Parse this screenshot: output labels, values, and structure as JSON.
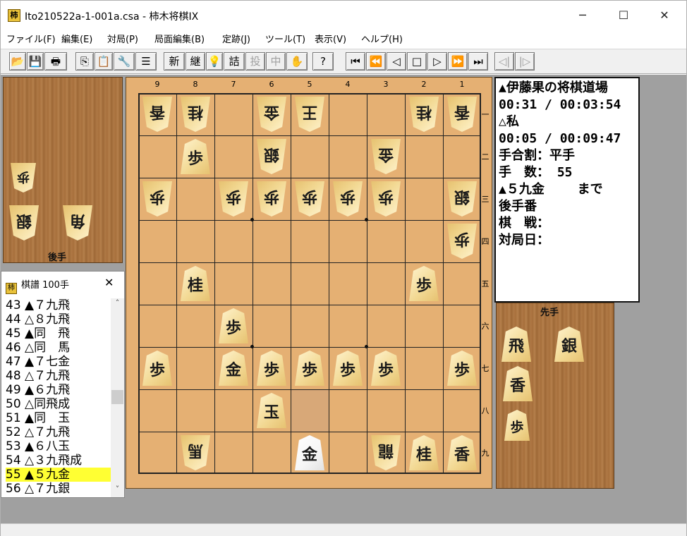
{
  "window": {
    "title": "Ito210522a-1-001a.csa - 柿木将棋IX",
    "app_icon": "柿",
    "minimize": "─",
    "maximize": "☐",
    "close": "✕"
  },
  "menu": [
    "ファイル(F)",
    "編集(E)",
    "対局(P)",
    "局面編集(B)",
    "定跡(J)",
    "ツール(T)",
    "表示(V)",
    "ヘルプ(H)"
  ],
  "toolbar": {
    "open": "📂",
    "save": "💾",
    "print": "🖶",
    "copy": "⎘",
    "paste": "📋",
    "tool": "🔧",
    "list": "☰",
    "new": "新",
    "continue": "継",
    "hint": "💡",
    "tsume": "詰",
    "resign": "投",
    "pause": "中",
    "hand": "✋",
    "help": "?",
    "first": "⏮",
    "back10": "⏪",
    "back": "◁",
    "stop": "□",
    "forward": "▷",
    "forward10": "⏩",
    "last": "⏭",
    "branch_back": "◁|",
    "branch_fwd": "|▷"
  },
  "board": {
    "file_labels": [
      "9",
      "8",
      "7",
      "6",
      "5",
      "4",
      "3",
      "2",
      "1"
    ],
    "rank_labels": [
      "一",
      "二",
      "三",
      "四",
      "五",
      "六",
      "七",
      "八",
      "九"
    ],
    "highlight_square": "5八",
    "pieces": [
      {
        "file": 9,
        "rank": 1,
        "char": "香",
        "owner": "gote"
      },
      {
        "file": 8,
        "rank": 1,
        "char": "桂",
        "owner": "gote"
      },
      {
        "file": 6,
        "rank": 1,
        "char": "金",
        "owner": "gote"
      },
      {
        "file": 5,
        "rank": 1,
        "char": "王",
        "owner": "gote"
      },
      {
        "file": 2,
        "rank": 1,
        "char": "桂",
        "owner": "gote"
      },
      {
        "file": 1,
        "rank": 1,
        "char": "香",
        "owner": "gote"
      },
      {
        "file": 8,
        "rank": 2,
        "char": "歩",
        "owner": "sente"
      },
      {
        "file": 6,
        "rank": 2,
        "char": "銀",
        "owner": "gote"
      },
      {
        "file": 3,
        "rank": 2,
        "char": "金",
        "owner": "gote"
      },
      {
        "file": 9,
        "rank": 3,
        "char": "歩",
        "owner": "gote"
      },
      {
        "file": 7,
        "rank": 3,
        "char": "歩",
        "owner": "gote"
      },
      {
        "file": 6,
        "rank": 3,
        "char": "歩",
        "owner": "gote"
      },
      {
        "file": 5,
        "rank": 3,
        "char": "歩",
        "owner": "gote"
      },
      {
        "file": 4,
        "rank": 3,
        "char": "歩",
        "owner": "gote"
      },
      {
        "file": 3,
        "rank": 3,
        "char": "歩",
        "owner": "gote"
      },
      {
        "file": 1,
        "rank": 3,
        "char": "銀",
        "owner": "gote"
      },
      {
        "file": 1,
        "rank": 4,
        "char": "歩",
        "owner": "gote"
      },
      {
        "file": 8,
        "rank": 5,
        "char": "桂",
        "owner": "sente"
      },
      {
        "file": 2,
        "rank": 5,
        "char": "歩",
        "owner": "sente"
      },
      {
        "file": 7,
        "rank": 6,
        "char": "歩",
        "owner": "sente"
      },
      {
        "file": 9,
        "rank": 7,
        "char": "歩",
        "owner": "sente"
      },
      {
        "file": 7,
        "rank": 7,
        "char": "金",
        "owner": "sente"
      },
      {
        "file": 6,
        "rank": 7,
        "char": "歩",
        "owner": "sente"
      },
      {
        "file": 5,
        "rank": 7,
        "char": "歩",
        "owner": "sente"
      },
      {
        "file": 4,
        "rank": 7,
        "char": "歩",
        "owner": "sente"
      },
      {
        "file": 3,
        "rank": 7,
        "char": "歩",
        "owner": "sente"
      },
      {
        "file": 1,
        "rank": 7,
        "char": "歩",
        "owner": "sente"
      },
      {
        "file": 6,
        "rank": 8,
        "char": "玉",
        "owner": "sente"
      },
      {
        "file": 8,
        "rank": 9,
        "char": "馬",
        "owner": "gote"
      },
      {
        "file": 5,
        "rank": 9,
        "char": "金",
        "owner": "sente",
        "last": true
      },
      {
        "file": 3,
        "rank": 9,
        "char": "龍",
        "owner": "gote"
      },
      {
        "file": 2,
        "rank": 9,
        "char": "桂",
        "owner": "sente"
      },
      {
        "file": 1,
        "rank": 9,
        "char": "香",
        "owner": "sente"
      }
    ]
  },
  "gote_hand": {
    "label": "後手",
    "pieces": [
      "歩",
      "銀",
      "角"
    ]
  },
  "sente_hand": {
    "label": "先手",
    "pieces": [
      "飛",
      "銀",
      "香",
      "歩"
    ]
  },
  "info": {
    "line1": "▲伊藤果の将棋道場",
    "line2": "00:31 / 00:03:54",
    "line3": "△私",
    "line4": "00:05 / 00:09:47",
    "line5": "手合割：平手",
    "line6": "手　数： 55",
    "line7": "▲５九金　　 まで",
    "line8": "後手番",
    "line9": "棋　戦：",
    "line10": "対局日："
  },
  "kifu": {
    "title": "棋譜 100手",
    "icon": "柿",
    "close": "✕",
    "scroll_up": "˄",
    "scroll_down": "˅",
    "selected_index": 12,
    "moves": [
      "43 ▲７九飛",
      "44 △８九飛",
      "45 ▲同　飛",
      "46 △同　馬",
      "47 ▲７七金",
      "48 △７九飛",
      "49 ▲６九飛",
      "50 △同飛成",
      "51 ▲同　玉",
      "52 △７九飛",
      "53 ▲６八玉",
      "54 △３九飛成",
      "55 ▲５九金",
      "56 △７九銀"
    ]
  }
}
